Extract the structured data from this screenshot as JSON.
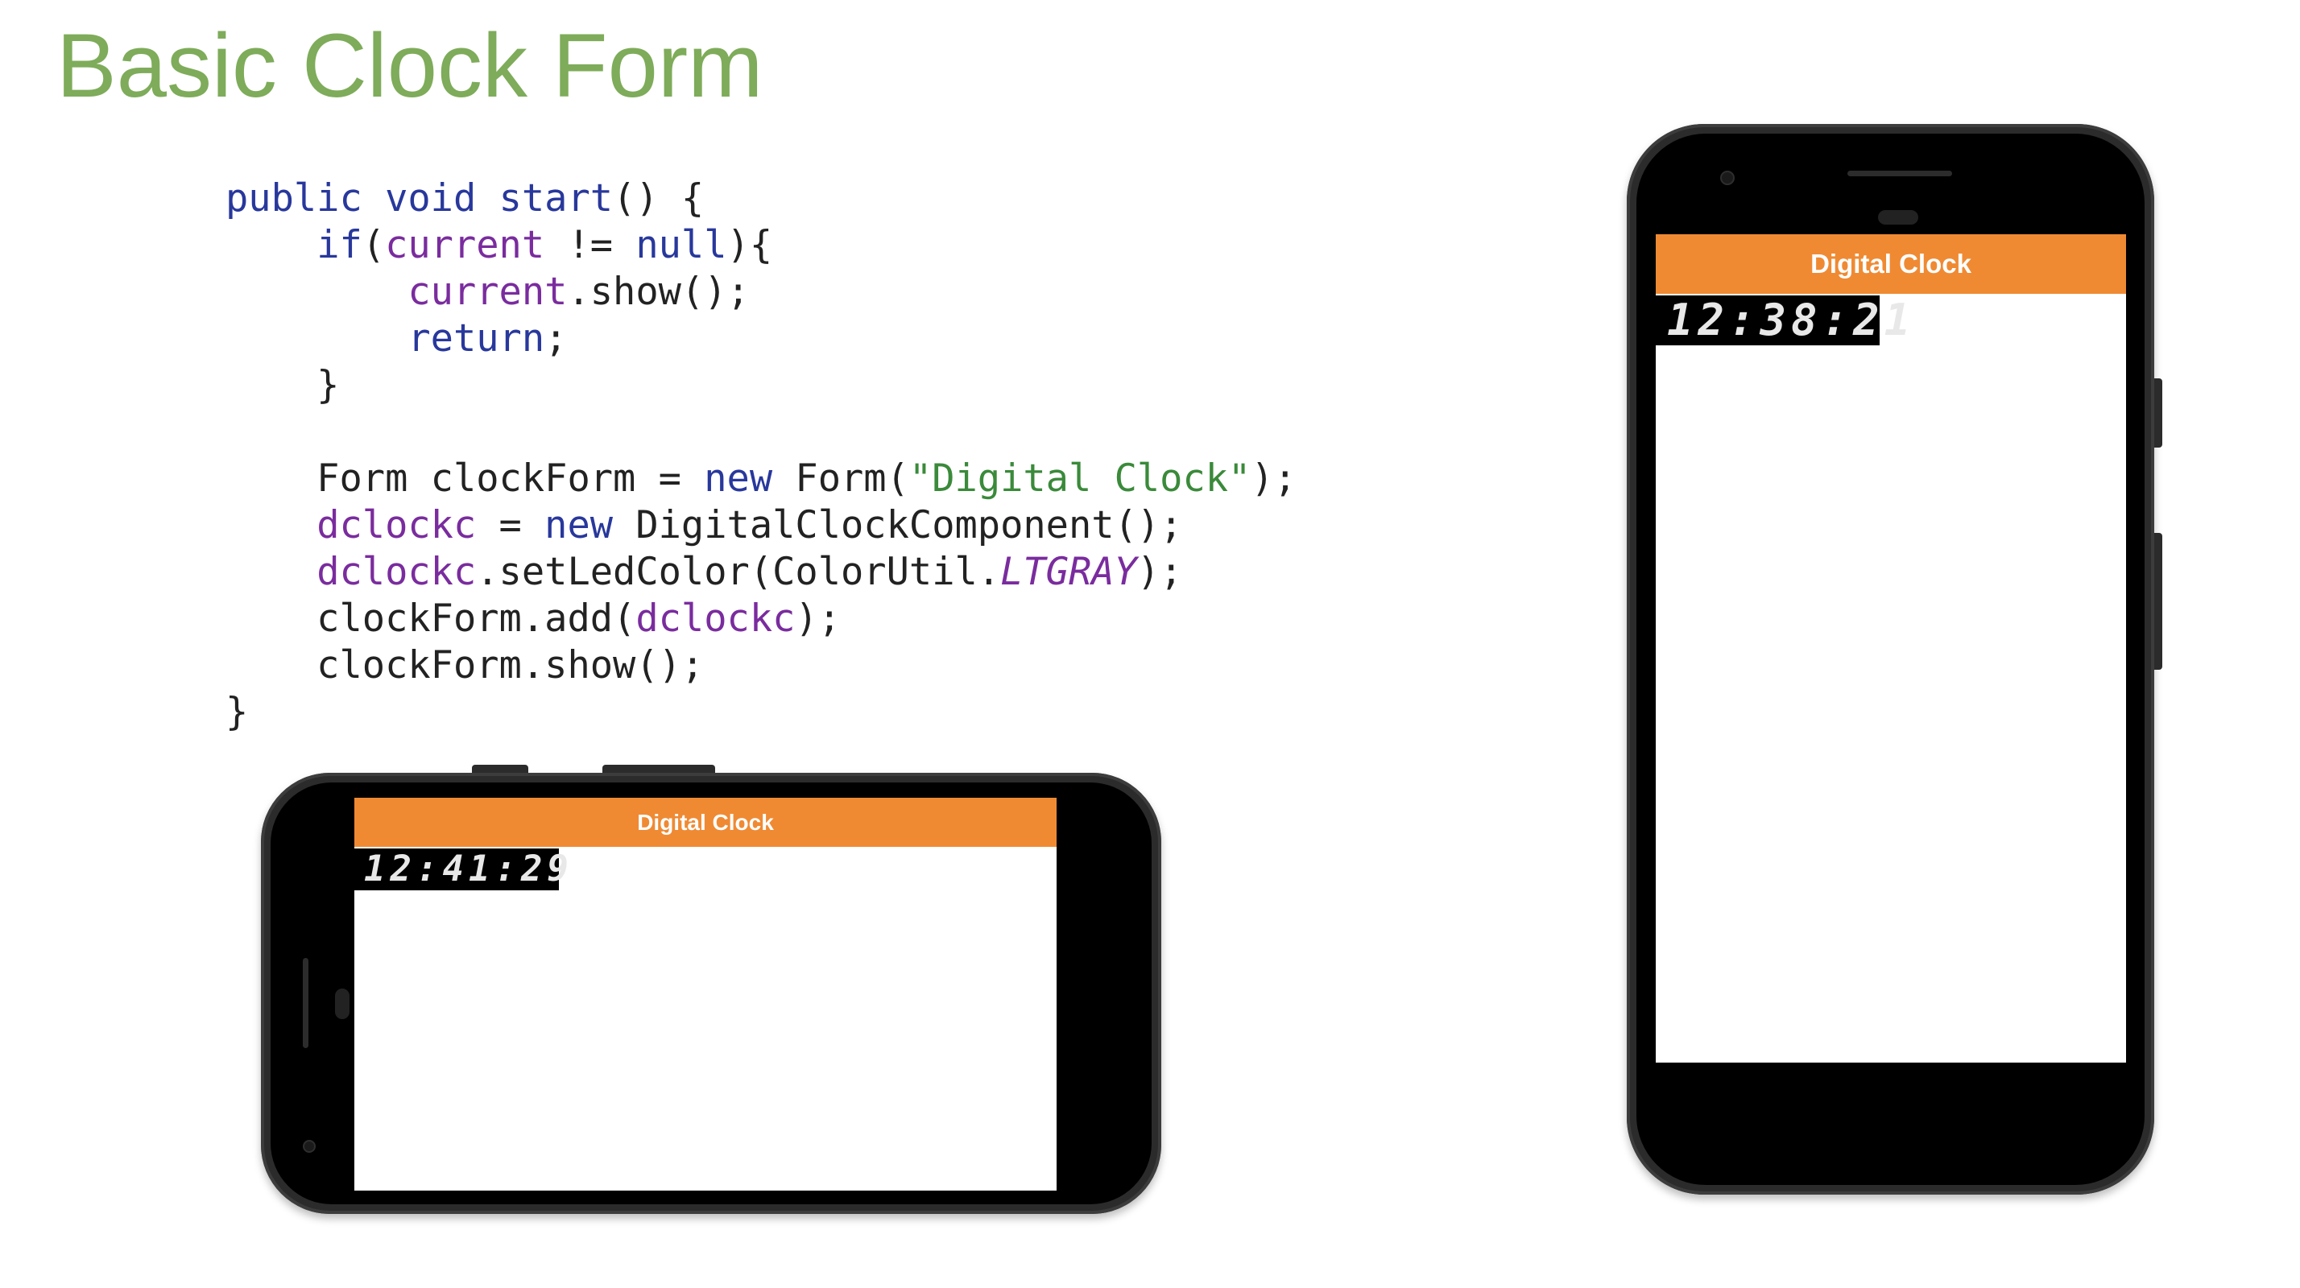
{
  "slide": {
    "title": "Basic Clock Form"
  },
  "code": {
    "lines": [
      [
        {
          "t": "public",
          "c": "kw"
        },
        {
          "t": " ",
          "c": "txt"
        },
        {
          "t": "void",
          "c": "kw"
        },
        {
          "t": " ",
          "c": "txt"
        },
        {
          "t": "start",
          "c": "kw"
        },
        {
          "t": "() {",
          "c": "txt"
        }
      ],
      [
        {
          "t": "    ",
          "c": "txt"
        },
        {
          "t": "if",
          "c": "kw"
        },
        {
          "t": "(",
          "c": "txt"
        },
        {
          "t": "current",
          "c": "fld"
        },
        {
          "t": " != ",
          "c": "txt"
        },
        {
          "t": "null",
          "c": "kw"
        },
        {
          "t": "){",
          "c": "txt"
        }
      ],
      [
        {
          "t": "        ",
          "c": "txt"
        },
        {
          "t": "current",
          "c": "fld"
        },
        {
          "t": ".show();",
          "c": "txt"
        }
      ],
      [
        {
          "t": "        ",
          "c": "txt"
        },
        {
          "t": "return",
          "c": "kw"
        },
        {
          "t": ";",
          "c": "txt"
        }
      ],
      [
        {
          "t": "    }",
          "c": "txt"
        }
      ],
      [],
      [
        {
          "t": "    Form clockForm = ",
          "c": "txt"
        },
        {
          "t": "new",
          "c": "kw"
        },
        {
          "t": " Form(",
          "c": "txt"
        },
        {
          "t": "\"Digital Clock\"",
          "c": "str"
        },
        {
          "t": ");",
          "c": "txt"
        }
      ],
      [
        {
          "t": "    ",
          "c": "txt"
        },
        {
          "t": "dclockc",
          "c": "fld"
        },
        {
          "t": " = ",
          "c": "txt"
        },
        {
          "t": "new",
          "c": "kw"
        },
        {
          "t": " DigitalClockComponent();",
          "c": "txt"
        }
      ],
      [
        {
          "t": "    ",
          "c": "txt"
        },
        {
          "t": "dclockc",
          "c": "fld"
        },
        {
          "t": ".setLedColor(ColorUtil.",
          "c": "txt"
        },
        {
          "t": "LTGRAY",
          "c": "ital"
        },
        {
          "t": ");",
          "c": "txt"
        }
      ],
      [
        {
          "t": "    clockForm.add(",
          "c": "txt"
        },
        {
          "t": "dclockc",
          "c": "fld"
        },
        {
          "t": ");",
          "c": "txt"
        }
      ],
      [
        {
          "t": "    clockForm.show();",
          "c": "txt"
        }
      ],
      [
        {
          "t": "}",
          "c": "txt"
        }
      ]
    ]
  },
  "phone_portrait": {
    "form_title": "Digital Clock",
    "clock_time": "12:38:21"
  },
  "phone_landscape": {
    "form_title": "Digital Clock",
    "clock_time": "12:41:29"
  },
  "colors": {
    "title_green": "#7eac5a",
    "keyword_blue": "#28389c",
    "field_purple": "#7a2c9e",
    "string_green": "#3a8a3a",
    "toolbar_orange": "#ef8a33",
    "phone_body": "#2b2b2b",
    "led_background": "#000000",
    "led_segment": "#e8e8e8"
  }
}
